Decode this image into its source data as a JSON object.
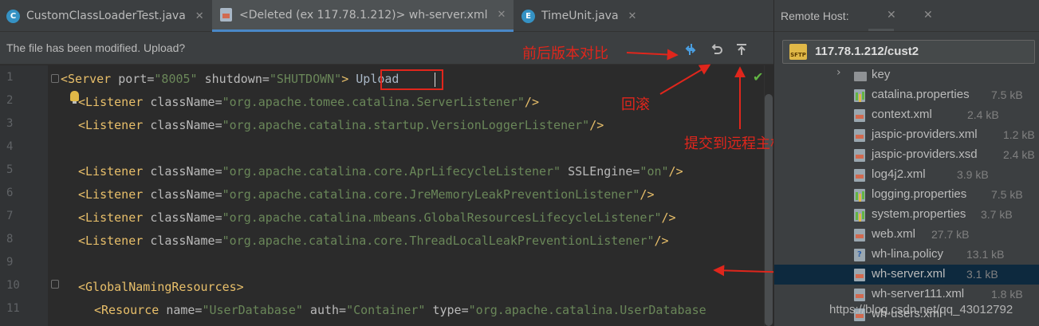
{
  "tabs": [
    {
      "label": "CustomClassLoaderTest.java",
      "icon": "java-class-icon",
      "icon_color": "#3592c4"
    },
    {
      "label": "<Deleted (ex 117.78.1.212)> wh-server.xml",
      "icon": "xml-file-icon",
      "active": true
    },
    {
      "label": "TimeUnit.java",
      "icon": "java-enum-icon",
      "icon_color": "#3592c4"
    }
  ],
  "tab_close": "✕",
  "notice": {
    "text": "The file has been modified. Upload?",
    "actions": {
      "compare": "compare-icon",
      "rollback": "rollback-icon",
      "upload": "upload-icon"
    }
  },
  "line_numbers": [
    "1",
    "2",
    "3",
    "4",
    "5",
    "6",
    "7",
    "8",
    "9",
    "10",
    "11"
  ],
  "code": {
    "l1": {
      "open": "<Server ",
      "a1": "port=",
      "v1": "\"8005\"",
      "a2": " shutdown=",
      "v2": "\"SHUTDOWN\"",
      "close": ">",
      "text": " Upload"
    },
    "l2": {
      "open": "<Listener ",
      "a1": "className=",
      "v1": "\"org.apache.tomee.catalina.ServerListener\"",
      "close": "/>"
    },
    "l3": {
      "open": "<Listener ",
      "a1": "className=",
      "v1": "\"org.apache.catalina.startup.VersionLoggerListener\"",
      "close": "/>"
    },
    "l5": {
      "open": "<Listener ",
      "a1": "className=",
      "v1": "\"org.apache.catalina.core.AprLifecycleListener\"",
      "a2": " SSLEngine=",
      "v2": "\"on\"",
      "close": "/>"
    },
    "l6": {
      "open": "<Listener ",
      "a1": "className=",
      "v1": "\"org.apache.catalina.core.JreMemoryLeakPreventionListener\"",
      "close": "/>"
    },
    "l7": {
      "open": "<Listener ",
      "a1": "className=",
      "v1": "\"org.apache.catalina.mbeans.GlobalResourcesLifecycleListener\"",
      "close": "/>"
    },
    "l8": {
      "open": "<Listener ",
      "a1": "className=",
      "v1": "\"org.apache.catalina.core.ThreadLocalLeakPreventionListener\"",
      "close": "/>"
    },
    "l10": {
      "open": "<GlobalNamingResources>"
    },
    "l11": {
      "open": "<Resource ",
      "a1": "name=",
      "v1": "\"UserDatabase\"",
      "a2": " auth=",
      "v2": "\"Container\"",
      "a3": " type=",
      "v3": "\"org.apache.catalina.UserDatabase"
    }
  },
  "annotations": {
    "compare": "前后版本对比",
    "rollback": "回滚",
    "upload": "提交到远程主机"
  },
  "remote": {
    "title": "Remote Host:",
    "close": "✕",
    "host": "117.78.1.212/cust2",
    "host_icon_text": "SFTP",
    "files": [
      {
        "name": "key",
        "size": "",
        "type": "folder"
      },
      {
        "name": "catalina.properties",
        "size": "7.5 kB",
        "type": "props"
      },
      {
        "name": "context.xml",
        "size": "2.4 kB",
        "type": "xml"
      },
      {
        "name": "jaspic-providers.xml",
        "size": "1.2 kB",
        "type": "xml"
      },
      {
        "name": "jaspic-providers.xsd",
        "size": "2.4 kB",
        "type": "xml"
      },
      {
        "name": "log4j2.xml",
        "size": "3.9 kB",
        "type": "xml"
      },
      {
        "name": "logging.properties",
        "size": "7.5 kB",
        "type": "props"
      },
      {
        "name": "system.properties",
        "size": "3.7 kB",
        "type": "props"
      },
      {
        "name": "web.xml",
        "size": "27.7 kB",
        "type": "xml"
      },
      {
        "name": "wh-lina.policy",
        "size": "13.1 kB",
        "type": "policy"
      },
      {
        "name": "wh-server.xml",
        "size": "3.1 kB",
        "type": "xml",
        "selected": true
      },
      {
        "name": "wh-server111.xml",
        "size": "1.8 kB",
        "type": "xml"
      },
      {
        "name": "wh-users.xml",
        "size": "",
        "type": "xml"
      }
    ]
  },
  "watermark": "https://blog.csdn.net/qq_43012792",
  "colors": {
    "accent": "#4a88c7",
    "annotation": "#e0261c",
    "selection": "#0d293e"
  }
}
